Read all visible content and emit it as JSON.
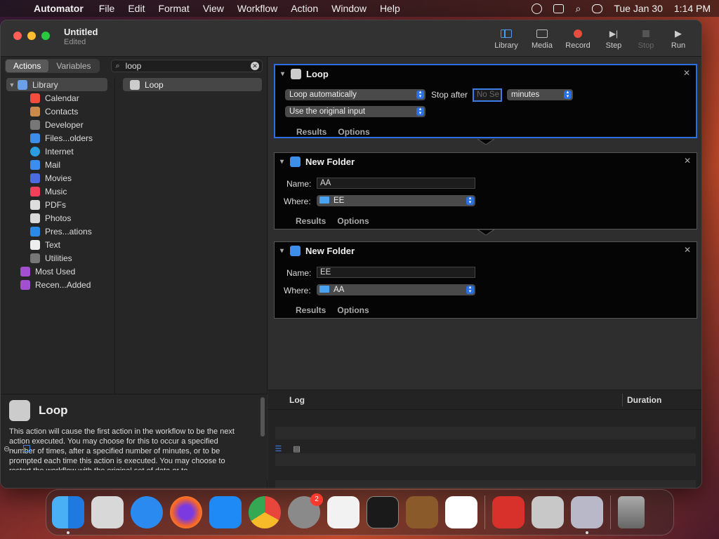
{
  "menubar": {
    "app": "Automator",
    "items": [
      "File",
      "Edit",
      "Format",
      "View",
      "Workflow",
      "Action",
      "Window",
      "Help"
    ],
    "date": "Tue Jan 30",
    "time": "1:14 PM"
  },
  "window": {
    "title": "Untitled",
    "subtitle": "Edited",
    "toolbar": {
      "library": "Library",
      "media": "Media",
      "record": "Record",
      "step": "Step",
      "stop": "Stop",
      "run": "Run"
    }
  },
  "left": {
    "tabs": [
      "Actions",
      "Variables"
    ],
    "search_value": "loop",
    "library_label": "Library",
    "categories": [
      "Calendar",
      "Contacts",
      "Developer",
      "Files...olders",
      "Internet",
      "Mail",
      "Movies",
      "Music",
      "PDFs",
      "Photos",
      "Pres...ations",
      "Text",
      "Utilities"
    ],
    "extra": [
      "Most Used",
      "Recen...Added"
    ],
    "action_result": "Loop",
    "description": {
      "title": "Loop",
      "text": "This action will cause the first action in the workflow to be the next action executed. You may choose for this to occur a specified number of times, after a specified number of minutes, or to be prompted each time this action is executed.  You may choose to restart the workflow with the original set of data or to"
    }
  },
  "actions": [
    {
      "title": "Loop",
      "popup1": "Loop automatically",
      "stop_after_label": "Stop after",
      "stop_after_placeholder": "No Se",
      "units": "minutes",
      "popup2": "Use the original input",
      "results": "Results",
      "options": "Options"
    },
    {
      "title": "New Folder",
      "name_label": "Name:",
      "name_value": "AA",
      "where_label": "Where:",
      "where_value": "EE",
      "results": "Results",
      "options": "Options"
    },
    {
      "title": "New Folder",
      "name_label": "Name:",
      "name_value": "EE",
      "where_label": "Where:",
      "where_value": "AA",
      "results": "Results",
      "options": "Options"
    }
  ],
  "log": {
    "col_log": "Log",
    "col_duration": "Duration"
  },
  "dock": {
    "apps": [
      "finder-icon",
      "launchpad-icon",
      "safari-icon",
      "firefox-icon",
      "app-store-icon",
      "chrome-icon",
      "system-settings-icon",
      "textedit-icon",
      "terminal-icon",
      "garageband-icon",
      "vscode-icon",
      "photo-booth-icon",
      "disk-utility-icon",
      "automator-icon",
      "trash-icon"
    ],
    "settings_badge": "2"
  },
  "colors": {
    "accent": "#2c6fe0",
    "record": "#e74c3c"
  }
}
